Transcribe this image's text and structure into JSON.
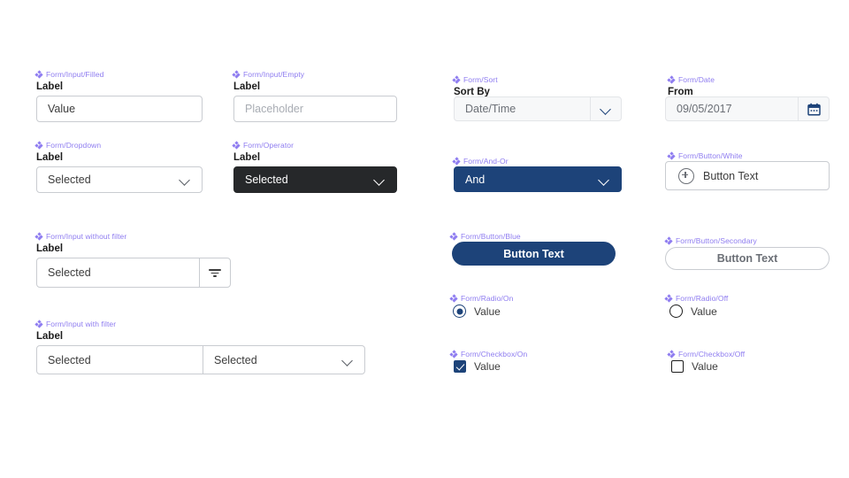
{
  "theme": {
    "instance_label_color": "#8e7cf0",
    "navy": "#1d4379",
    "dark": "#26282a",
    "border": "#c9ccd1",
    "placeholder": "#a8acb3",
    "text": "#3c3c3c",
    "background": "#ffffff"
  },
  "components": {
    "input_filled": {
      "instance": "Form/Input/Filled",
      "label": "Label",
      "value": "Value"
    },
    "input_empty": {
      "instance": "Form/Input/Empty",
      "label": "Label",
      "placeholder": "Placeholder"
    },
    "dropdown": {
      "instance": "Form/Dropdown",
      "label": "Label",
      "value": "Selected",
      "icon": "chevron-down-icon"
    },
    "operator": {
      "instance": "Form/Operator",
      "label": "Label",
      "value": "Selected",
      "icon": "chevron-down-icon"
    },
    "input_without_filter": {
      "instance": "Form/Input without filter",
      "label": "Label",
      "value": "Selected",
      "icon": "filter-icon"
    },
    "input_with_filter": {
      "instance": "Form/Input with filter",
      "label": "Label",
      "value_left": "Selected",
      "value_right": "Selected",
      "icon": "chevron-down-icon"
    },
    "sort": {
      "instance": "Form/Sort",
      "label": "Sort By",
      "value": "Date/Time",
      "icon": "chevron-down-icon"
    },
    "date": {
      "instance": "Form/Date",
      "label": "From",
      "value": "09/05/2017",
      "icon": "calendar-icon"
    },
    "and_or": {
      "instance": "Form/And-Or",
      "value": "And",
      "icon": "chevron-down-icon"
    },
    "button_white": {
      "instance": "Form/Button/White",
      "text": "Button Text",
      "icon": "plus-circle-icon"
    },
    "button_blue": {
      "instance": "Form/Button/Blue",
      "text": "Button Text"
    },
    "button_secondary": {
      "instance": "Form/Button/Secondary",
      "text": "Button Text"
    },
    "radio_on": {
      "instance": "Form/Radio/On",
      "label": "Value"
    },
    "radio_off": {
      "instance": "Form/Radio/Off",
      "label": "Value"
    },
    "checkbox_on": {
      "instance": "Form/Checkbox/On",
      "label": "Value"
    },
    "checkbox_off": {
      "instance": "Form/Checkbox/Off",
      "label": "Value"
    }
  }
}
